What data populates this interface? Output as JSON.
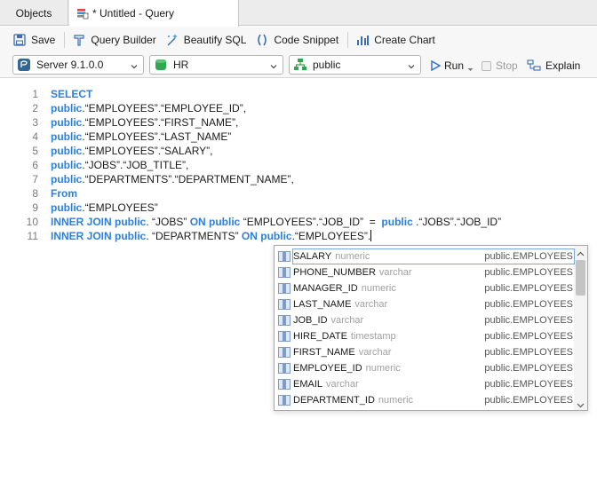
{
  "tabs": {
    "objects_label": "Objects",
    "query_label": "* Untitled - Query"
  },
  "toolbar": {
    "save_label": "Save",
    "query_builder_label": "Query Builder",
    "beautify_label": "Beautify SQL",
    "snippet_label": "Code Snippet",
    "chart_label": "Create Chart"
  },
  "selectors": {
    "server": "Server 9.1.0.0",
    "database": "HR",
    "schema": "public",
    "run_label": "Run",
    "stop_label": "Stop",
    "explain_label": "Explain"
  },
  "editor": {
    "lines": [
      {
        "num": "1",
        "parts": [
          {
            "t": "SELECT",
            "kw": true
          }
        ]
      },
      {
        "num": "2",
        "parts": [
          {
            "t": "public",
            "kw": true
          },
          {
            "t": ".“EMPLOYEES”.“EMPLOYEE_ID”,",
            "kw": false
          }
        ]
      },
      {
        "num": "3",
        "parts": [
          {
            "t": "public",
            "kw": true
          },
          {
            "t": ".“EMPLOYEES”.“FIRST_NAME”,",
            "kw": false
          }
        ]
      },
      {
        "num": "4",
        "parts": [
          {
            "t": "public",
            "kw": true
          },
          {
            "t": ".“EMPLOYEES”.“LAST_NAME”",
            "kw": false
          }
        ]
      },
      {
        "num": "5",
        "parts": [
          {
            "t": "public",
            "kw": true
          },
          {
            "t": ".“EMPLOYEES”.“SALARY”,",
            "kw": false
          }
        ]
      },
      {
        "num": "6",
        "parts": [
          {
            "t": "public",
            "kw": true
          },
          {
            "t": ".“JOBS”.“JOB_TITLE”,",
            "kw": false
          }
        ]
      },
      {
        "num": "7",
        "parts": [
          {
            "t": "public",
            "kw": true
          },
          {
            "t": ".“DEPARTMENTS”.“DEPARTMENT_NAME”,",
            "kw": false
          }
        ]
      },
      {
        "num": "8",
        "parts": [
          {
            "t": "From",
            "kw": true
          }
        ]
      },
      {
        "num": "9",
        "parts": [
          {
            "t": "public",
            "kw": true
          },
          {
            "t": ".“EMPLOYEES”",
            "kw": false
          }
        ]
      },
      {
        "num": "10",
        "parts": [
          {
            "t": "INNER JOIN public",
            "kw": true
          },
          {
            "t": ". “JOBS” ",
            "kw": false
          },
          {
            "t": "ON public",
            "kw": true
          },
          {
            "t": " “EMPLOYEES”.“JOB_ID”  =  ",
            "kw": false
          },
          {
            "t": "public",
            "kw": true
          },
          {
            "t": " .“JOBS”.“JOB_ID”",
            "kw": false
          }
        ]
      },
      {
        "num": "11",
        "parts": [
          {
            "t": "INNER JOIN public",
            "kw": true
          },
          {
            "t": ". “DEPARTMENTS” ",
            "kw": false
          },
          {
            "t": "ON public",
            "kw": true
          },
          {
            "t": ".“EMPLOYEES”.",
            "kw": false
          }
        ],
        "caret": true
      }
    ]
  },
  "autocomplete": {
    "items": [
      {
        "name": "SALARY",
        "type": "numeric",
        "table": "public.EMPLOYEES"
      },
      {
        "name": "PHONE_NUMBER",
        "type": "varchar",
        "table": "public.EMPLOYEES"
      },
      {
        "name": "MANAGER_ID",
        "type": "numeric",
        "table": "public.EMPLOYEES"
      },
      {
        "name": "LAST_NAME",
        "type": "varchar",
        "table": "public.EMPLOYEES"
      },
      {
        "name": "JOB_ID",
        "type": "varchar",
        "table": "public.EMPLOYEES"
      },
      {
        "name": "HIRE_DATE",
        "type": "timestamp",
        "table": "public.EMPLOYEES"
      },
      {
        "name": "FIRST_NAME",
        "type": "varchar",
        "table": "public.EMPLOYEES"
      },
      {
        "name": "EMPLOYEE_ID",
        "type": "numeric",
        "table": "public.EMPLOYEES"
      },
      {
        "name": "EMAIL",
        "type": "varchar",
        "table": "public.EMPLOYEES"
      },
      {
        "name": "DEPARTMENT_ID",
        "type": "numeric",
        "table": "public.EMPLOYEES"
      }
    ]
  },
  "colors": {
    "keyword": "#2f7fd8",
    "accent": "#2a6fcf"
  }
}
